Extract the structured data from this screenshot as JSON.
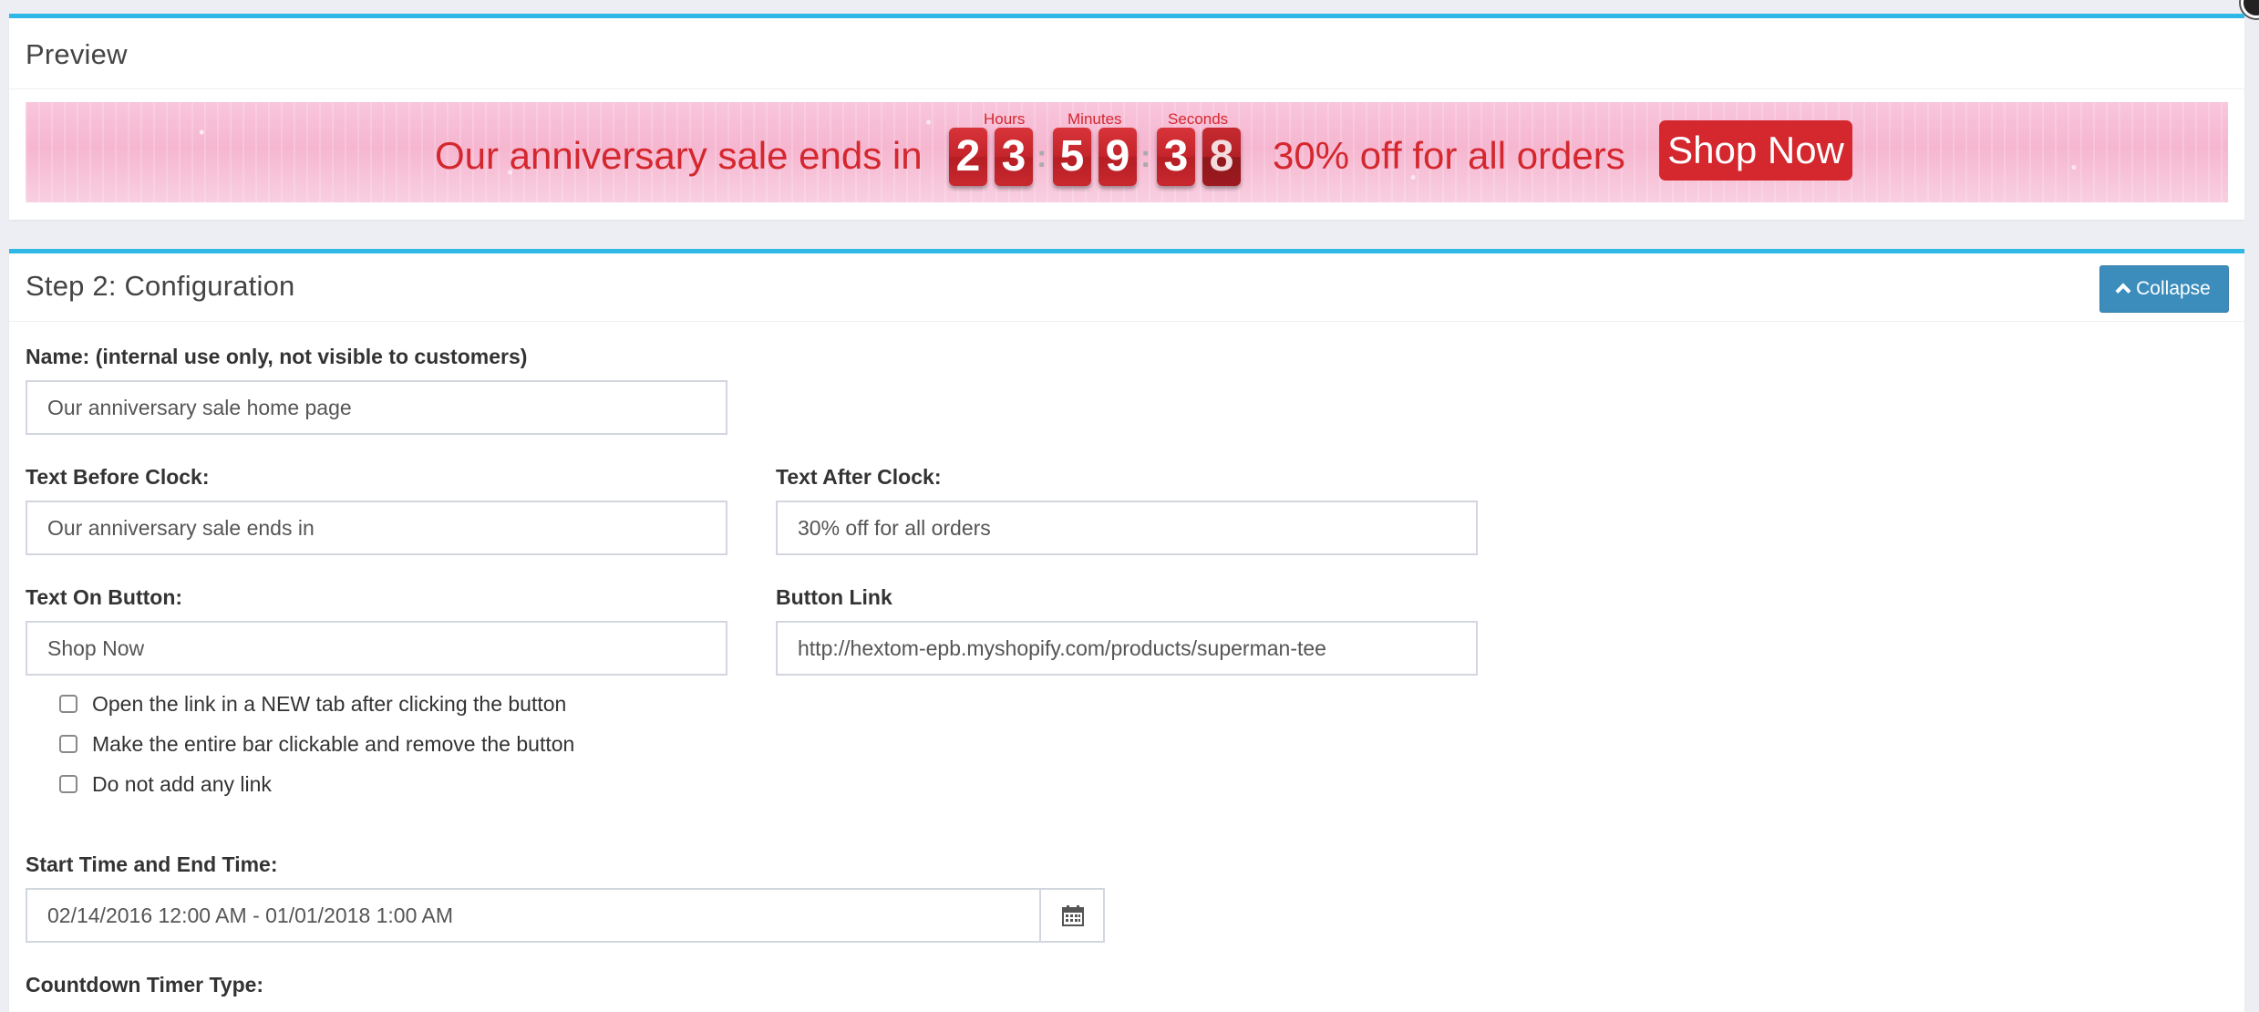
{
  "preview": {
    "title": "Preview",
    "banner": {
      "text_before": "Our anniversary sale ends in",
      "text_after": "30% off for all orders",
      "button_label": "Shop Now",
      "labels": {
        "hours": "Hours",
        "minutes": "Minutes",
        "seconds": "Seconds"
      },
      "digits": {
        "h1": "2",
        "h2": "3",
        "m1": "5",
        "m2": "9",
        "s1": "3",
        "s2": "8"
      },
      "colon": ":",
      "text_color": "#d4272e",
      "background_color": "#f6b6d0"
    }
  },
  "config": {
    "title": "Step 2: Configuration",
    "collapse_label": "Collapse",
    "fields": {
      "name_label": "Name: (internal use only, not visible to customers)",
      "name_value": "Our anniversary sale home page",
      "before_label": "Text Before Clock:",
      "before_value": "Our anniversary sale ends in",
      "after_label": "Text After Clock:",
      "after_value": "30% off for all orders",
      "button_text_label": "Text On Button:",
      "button_text_value": "Shop Now",
      "button_link_label": "Button Link",
      "button_link_value": "http://hextom-epb.myshopify.com/products/superman-tee",
      "time_label": "Start Time and End Time:",
      "time_value": "02/14/2016 12:00 AM - 01/01/2018 1:00 AM",
      "timer_type_label": "Countdown Timer Type:"
    },
    "checkboxes": [
      {
        "label": "Open the link in a NEW tab after clicking the button",
        "checked": false
      },
      {
        "label": "Make the entire bar clickable and remove the button",
        "checked": false
      },
      {
        "label": "Do not add any link",
        "checked": false
      }
    ],
    "calendar_icon": "calendar-icon",
    "accent_color": "#2fb8e6",
    "button_color": "#3c8dbc"
  }
}
